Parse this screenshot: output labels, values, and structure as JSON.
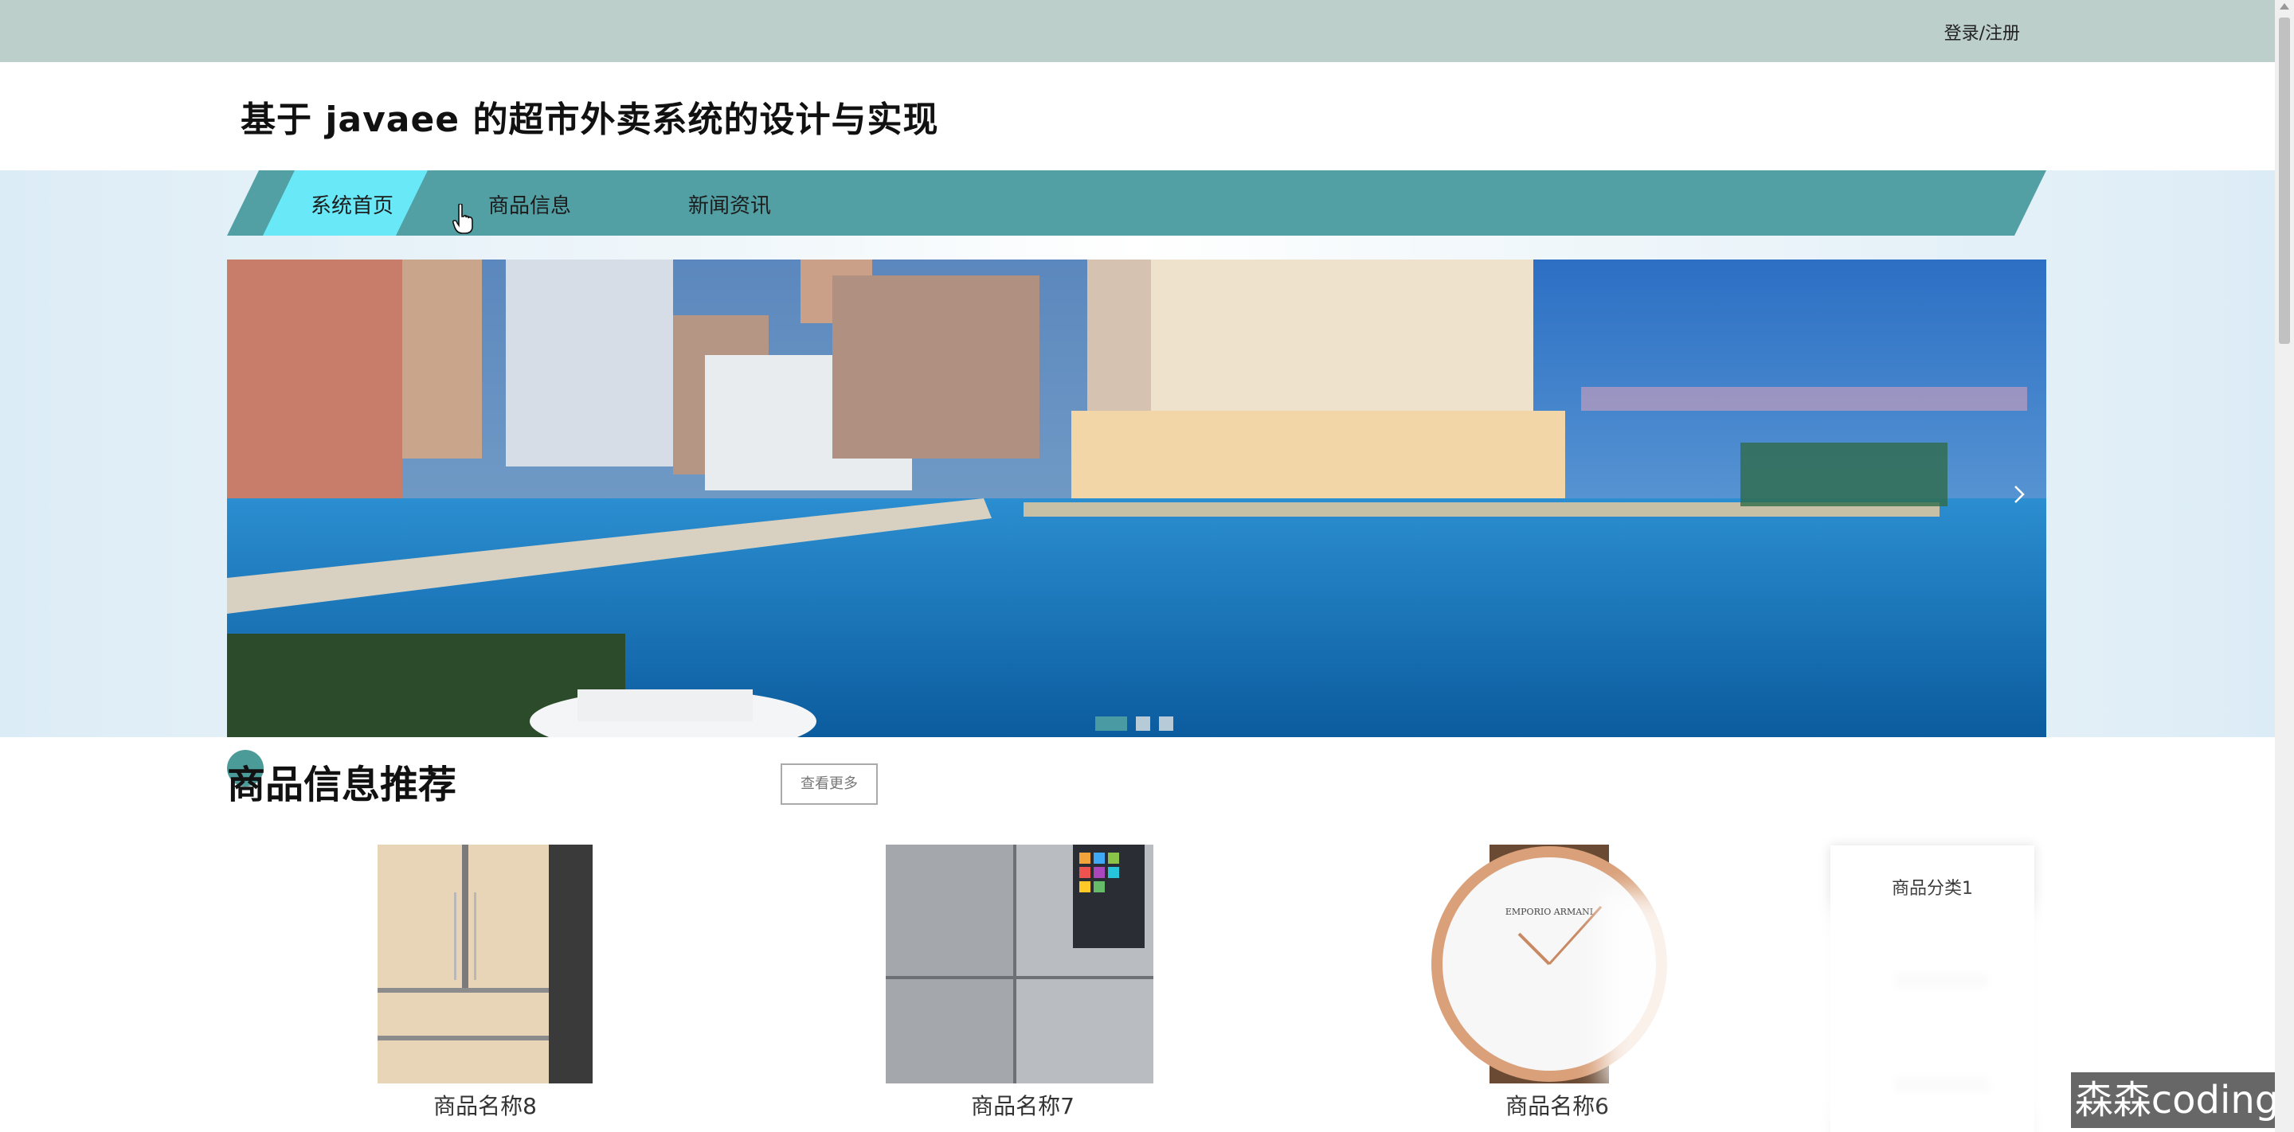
{
  "topbar": {
    "login_label": "登录/注册"
  },
  "header": {
    "title": "基于 javaee 的超市外卖系统的设计与实现"
  },
  "nav": {
    "items": [
      {
        "label": "系统首页"
      },
      {
        "label": "商品信息"
      },
      {
        "label": "新闻资讯"
      }
    ]
  },
  "banner": {
    "next_icon": "chevron-right-icon",
    "slides": 3,
    "active_slide": 1
  },
  "section": {
    "title": "商品信息推荐",
    "more_label": "查看更多"
  },
  "products": [
    {
      "name": "商品名称8"
    },
    {
      "name": "商品名称7"
    },
    {
      "name": "商品名称6"
    }
  ],
  "categories": [
    {
      "label": "商品分类1"
    }
  ],
  "watermark": {
    "text": "森森coding"
  },
  "colors": {
    "nav_bg": "#529fa4",
    "nav_active": "#69e8f7",
    "topbar": "#bccfcb",
    "accent": "#4b9b99"
  }
}
